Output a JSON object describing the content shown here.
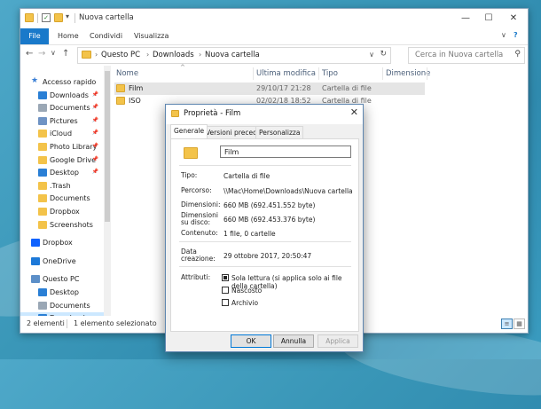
{
  "explorer": {
    "title": "Nuova cartella",
    "ribbon": {
      "tabs": [
        "File",
        "Home",
        "Condividi",
        "Visualizza"
      ]
    },
    "path": [
      "Questo PC",
      "Downloads",
      "Nuova cartella"
    ],
    "search_placeholder": "Cerca in Nuova cartella",
    "nav": {
      "items": [
        {
          "label": "Accesso rapido",
          "icon": "star-icon",
          "level": 0
        },
        {
          "label": "Downloads",
          "icon": "download-icon",
          "level": 1,
          "pinned": true
        },
        {
          "label": "Documents",
          "icon": "document-icon",
          "level": 1,
          "pinned": true
        },
        {
          "label": "Pictures",
          "icon": "pictures-icon",
          "level": 1,
          "pinned": true
        },
        {
          "label": "iCloud",
          "icon": "folder-icon",
          "level": 1,
          "pinned": true
        },
        {
          "label": "Photo Library",
          "icon": "folder-icon",
          "level": 1,
          "pinned": true
        },
        {
          "label": "Google Drive",
          "icon": "folder-icon",
          "level": 1,
          "pinned": true
        },
        {
          "label": "Desktop",
          "icon": "desktop-icon",
          "level": 1,
          "pinned": true
        },
        {
          "label": ".Trash",
          "icon": "folder-icon",
          "level": 1
        },
        {
          "label": "Documents",
          "icon": "folder-icon",
          "level": 1
        },
        {
          "label": "Dropbox",
          "icon": "folder-icon",
          "level": 1
        },
        {
          "label": "Screenshots",
          "icon": "folder-icon",
          "level": 1
        },
        {
          "label": "Dropbox",
          "icon": "dropbox-icon",
          "level": 0
        },
        {
          "label": "OneDrive",
          "icon": "onedrive-icon",
          "level": 0
        },
        {
          "label": "Questo PC",
          "icon": "computer-icon",
          "level": 0
        },
        {
          "label": "Desktop",
          "icon": "desktop-icon",
          "level": 1
        },
        {
          "label": "Documents",
          "icon": "document-icon",
          "level": 1
        },
        {
          "label": "Downloads",
          "icon": "download-icon",
          "level": 1,
          "selected": true
        }
      ]
    },
    "columns": [
      "Nome",
      "Ultima modifica",
      "Tipo",
      "Dimensione"
    ],
    "files": [
      {
        "name": "Film",
        "modified": "29/10/17 21:28",
        "type": "Cartella di file",
        "selected": true
      },
      {
        "name": "ISO",
        "modified": "02/02/18 18:52",
        "type": "Cartella di file"
      }
    ],
    "status": {
      "count": "2 elementi",
      "selection": "1 elemento selezionato"
    }
  },
  "dialog": {
    "title": "Proprietà - Film",
    "tabs": [
      "Generale",
      "Versioni precedenti",
      "Personalizza"
    ],
    "name": "Film",
    "labels": {
      "tipo": "Tipo:",
      "percorso": "Percorso:",
      "dimensioni": "Dimensioni:",
      "dim_disco_1": "Dimensioni",
      "dim_disco_2": "su disco:",
      "contenuto": "Contenuto:",
      "data_1": "Data",
      "data_2": "creazione:",
      "attributi": "Attributi:"
    },
    "values": {
      "tipo": "Cartella di file",
      "percorso": "\\\\Mac\\Home\\Downloads\\Nuova cartella",
      "dimensioni": "660 MB (692.451.552 byte)",
      "dim_disco": "660 MB (692.453.376 byte)",
      "contenuto": "1 file, 0 cartelle",
      "data": "29 ottobre 2017, 20:50:47"
    },
    "attributes": [
      {
        "label": "Sola lettura (si applica solo ai file della cartella)",
        "checked": true
      },
      {
        "label": "Nascosto",
        "checked": false
      },
      {
        "label": "Archivio",
        "checked": false
      }
    ],
    "buttons": {
      "ok": "OK",
      "cancel": "Annulla",
      "apply": "Applica"
    }
  },
  "colors": {
    "accent": "#1979ca",
    "folder": "#f3c34a",
    "selection": "#cce8ff"
  }
}
